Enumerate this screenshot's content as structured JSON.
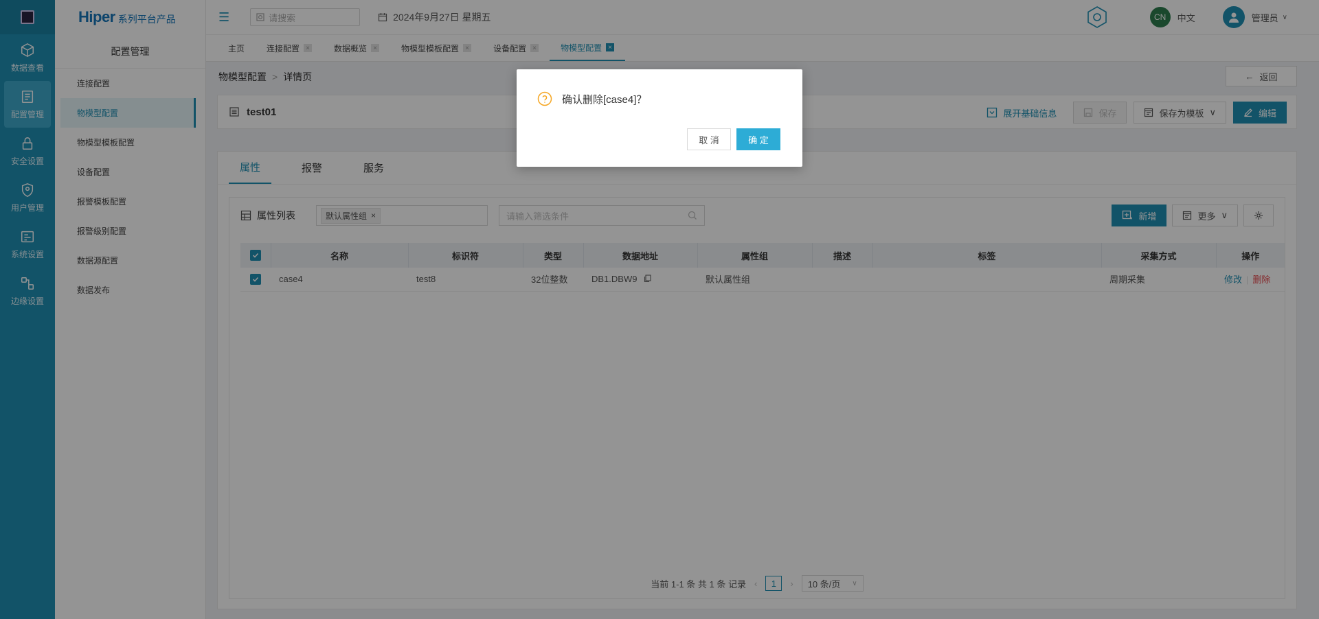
{
  "rail": {
    "items": [
      {
        "label": "数据查看",
        "icon": "cube-icon"
      },
      {
        "label": "配置管理",
        "icon": "config-icon"
      },
      {
        "label": "安全设置",
        "icon": "lock-icon"
      },
      {
        "label": "用户管理",
        "icon": "shield-user-icon"
      },
      {
        "label": "系统设置",
        "icon": "system-icon"
      },
      {
        "label": "边缘设置",
        "icon": "edge-icon"
      }
    ],
    "active_index": 1
  },
  "brand": {
    "main": "Hiper",
    "sub": "系列平台产品"
  },
  "sidenav": {
    "title": "配置管理",
    "items": [
      "连接配置",
      "物模型配置",
      "物模型模板配置",
      "设备配置",
      "报警模板配置",
      "报警级别配置",
      "数据源配置",
      "数据发布"
    ],
    "active_index": 1
  },
  "header": {
    "search_placeholder": "请搜索",
    "date": "2024年9月27日 星期五",
    "lang_badge": "CN",
    "lang": "中文",
    "user": "管理员"
  },
  "tabs": {
    "items": [
      "主页",
      "连接配置",
      "数据概览",
      "物模型模板配置",
      "设备配置",
      "物模型配置"
    ],
    "active_index": 5
  },
  "breadcrumb": {
    "parent": "物模型配置",
    "current": "详情页",
    "back": "返回"
  },
  "titlecard": {
    "name": "test01",
    "expand": "展开基础信息",
    "save": "保存",
    "save_template": "保存为模板",
    "edit": "编辑"
  },
  "subtabs": {
    "items": [
      "属性",
      "报警",
      "服务"
    ],
    "active_index": 0
  },
  "toolbar": {
    "title": "属性列表",
    "tag": "默认属性组",
    "filter_placeholder": "请输入筛选条件",
    "add": "新增",
    "more": "更多"
  },
  "table": {
    "columns": [
      "名称",
      "标识符",
      "类型",
      "数据地址",
      "属性组",
      "描述",
      "标签",
      "采集方式",
      "操作"
    ],
    "rows": [
      {
        "name": "case4",
        "identifier": "test8",
        "type": "32位整数",
        "address": "DB1.DBW9",
        "group": "默认属性组",
        "desc": "",
        "tags": "",
        "mode": "周期采集",
        "edit": "修改",
        "delete": "删除"
      }
    ]
  },
  "pager": {
    "summary": "当前 1-1 条 共 1 条 记录",
    "page": "1",
    "size": "10 条/页"
  },
  "dialog": {
    "message": "确认删除[case4]？",
    "cancel": "取 消",
    "ok": "确 定"
  },
  "colors": {
    "primary": "#1f8fb3",
    "danger": "#e5484d",
    "warn": "#f5a623"
  }
}
